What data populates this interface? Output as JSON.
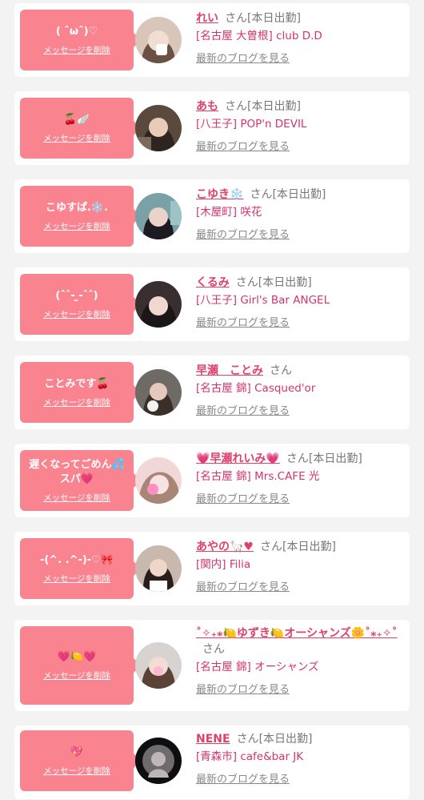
{
  "cards": [
    {
      "message": "( ˆωˆ)♡",
      "delete": "メッセージを削除",
      "name": "れい",
      "san": "さん",
      "duty": "[本日出勤]",
      "shop": "[名古屋 大曽根] club D.D",
      "blog": "最新のブログを見る",
      "avatar_colors": [
        "#d9c6bb",
        "#6b5044",
        "#f2ddd2"
      ]
    },
    {
      "message": "🍒🪽",
      "delete": "メッセージを削除",
      "name": "あも",
      "san": "さん",
      "duty": "[本日出勤]",
      "shop": "[八王子] POP'n DEVIL",
      "blog": "最新のブログを見る",
      "avatar_colors": [
        "#5a4a3d",
        "#2f2520",
        "#e8cbb8"
      ]
    },
    {
      "message": "こゆすぱ.❄️.",
      "delete": "メッセージを削除",
      "name": "こゆき❄️",
      "san": "さん",
      "duty": "[本日出勤]",
      "shop": "[木屋町] 咲花",
      "blog": "最新のブログを見る",
      "avatar_colors": [
        "#7aa0a8",
        "#1d1b22",
        "#ead3c8"
      ]
    },
    {
      "message": "(ˆˆ- ̫-ˆˆ)",
      "delete": "メッセージを削除",
      "name": "くるみ",
      "san": "さん",
      "duty": "[本日出勤]",
      "shop": "[八王子] Girl's Bar ANGEL",
      "blog": "最新のブログを見る",
      "avatar_colors": [
        "#3a2f30",
        "#1b1617",
        "#f0d8d0"
      ]
    },
    {
      "message": "ことみです🍒",
      "delete": "メッセージを削除",
      "name": "早瀬　ことみ",
      "san": "さん",
      "duty": "",
      "shop": "[名古屋 錦] Casqued'or",
      "blog": "最新のブログを見る",
      "avatar_colors": [
        "#6e6a66",
        "#3b2f2a",
        "#e5c9bd"
      ]
    },
    {
      "message": "遅くなってごめん💦スパ💗",
      "delete": "メッセージを削除",
      "name": "💗早瀬れいみ💗",
      "san": "さん",
      "duty": "[本日出勤]",
      "shop": "[名古屋 錦] Mrs.CAFE 光",
      "blog": "最新のブログを見る",
      "avatar_colors": [
        "#f2d7d9",
        "#a88574",
        "#f7e4e2"
      ]
    },
    {
      "message": "-(^. .^-)-♡🎀",
      "delete": "メッセージを削除",
      "name": "あやの🦙♥",
      "san": "さん",
      "duty": "[本日出勤]",
      "shop": "[関内] Filia",
      "blog": "最新のブログを見る",
      "avatar_colors": [
        "#c9b8ae",
        "#2a1e1b",
        "#eed6c9"
      ]
    },
    {
      "message": "💗🍋💗",
      "delete": "メッセージを削除",
      "name": "˚✧₊⁎🍋ゆずき🍋オーシャンズ🌼˚⁎₊✧˚",
      "san": "さん",
      "duty": "",
      "shop": "[名古屋 錦] オーシャンズ",
      "blog": "最新のブログを見る",
      "avatar_colors": [
        "#d8d2d0",
        "#5b4236",
        "#f3dcd3"
      ]
    },
    {
      "message": "💖",
      "delete": "メッセージを削除",
      "name": "NENE",
      "san": "さん",
      "duty": "[本日出勤]",
      "shop": "[青森市] cafe&bar JK",
      "blog": "最新のブログを見る",
      "avatar_colors": [
        "#0e0e10",
        "#6f6a6e",
        "#bfb6b8"
      ]
    }
  ]
}
